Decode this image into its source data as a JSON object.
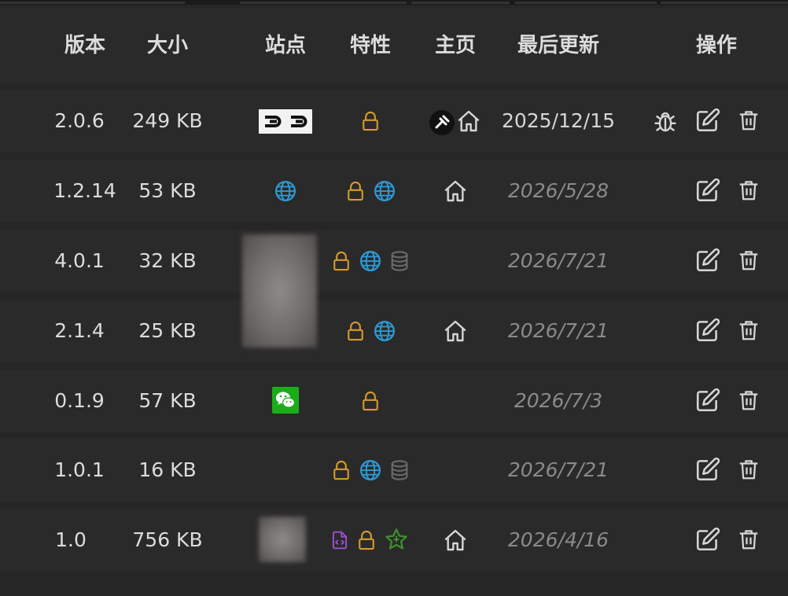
{
  "columns": {
    "version": "版本",
    "size": "大小",
    "sites": "站点",
    "features": "特性",
    "homepage": "主页",
    "updated": "最后更新",
    "actions": "操作"
  },
  "rows": [
    {
      "version": "2.0.6",
      "size": "249 KB",
      "updated": "2025/12/15",
      "sites": [
        "site-badge-arrows"
      ],
      "features": [
        "lock-icon"
      ],
      "homepage": [
        "site-favicon",
        "home-icon"
      ],
      "actions": [
        "bug-icon",
        "edit-icon",
        "delete-icon"
      ]
    },
    {
      "version": "1.2.14",
      "size": "53 KB",
      "updated": "2026/5/28",
      "sites": [
        "globe-icon"
      ],
      "features": [
        "lock-icon",
        "globe-icon"
      ],
      "homepage": [
        "home-icon"
      ],
      "actions": [
        "edit-icon",
        "delete-icon"
      ]
    },
    {
      "version": "4.0.1",
      "size": "32 KB",
      "updated": "2026/7/21",
      "sites": [
        "blurred-image"
      ],
      "features": [
        "lock-icon",
        "globe-icon",
        "database-icon"
      ],
      "homepage": [],
      "actions": [
        "edit-icon",
        "delete-icon"
      ]
    },
    {
      "version": "2.1.4",
      "size": "25 KB",
      "updated": "2026/7/21",
      "sites": [
        "blurred-image"
      ],
      "features": [
        "lock-icon",
        "globe-icon"
      ],
      "homepage": [
        "home-icon"
      ],
      "actions": [
        "edit-icon",
        "delete-icon"
      ]
    },
    {
      "version": "0.1.9",
      "size": "57 KB",
      "updated": "2026/7/3",
      "sites": [
        "wechat-icon"
      ],
      "features": [
        "lock-icon"
      ],
      "homepage": [],
      "actions": [
        "edit-icon",
        "delete-icon"
      ]
    },
    {
      "version": "1.0.1",
      "size": "16 KB",
      "updated": "2026/7/21",
      "sites": [],
      "features": [
        "lock-icon",
        "globe-icon",
        "database-icon"
      ],
      "homepage": [],
      "actions": [
        "edit-icon",
        "delete-icon"
      ]
    },
    {
      "version": "1.0",
      "size": "756 KB",
      "updated": "2026/4/16",
      "sites": [
        "blurred-image"
      ],
      "features": [
        "code-file-icon",
        "lock-icon",
        "star-icon"
      ],
      "homepage": [
        "home-icon"
      ],
      "actions": [
        "edit-icon",
        "delete-icon"
      ]
    }
  ],
  "colors": {
    "lock": "#d79a2b",
    "globe": "#2a9ad6",
    "database": "#6b6b6b",
    "code_file": "#a04fd6",
    "star": "#3f8f2e",
    "wechat": "#1aad19",
    "icon": "#d6d6d6"
  }
}
